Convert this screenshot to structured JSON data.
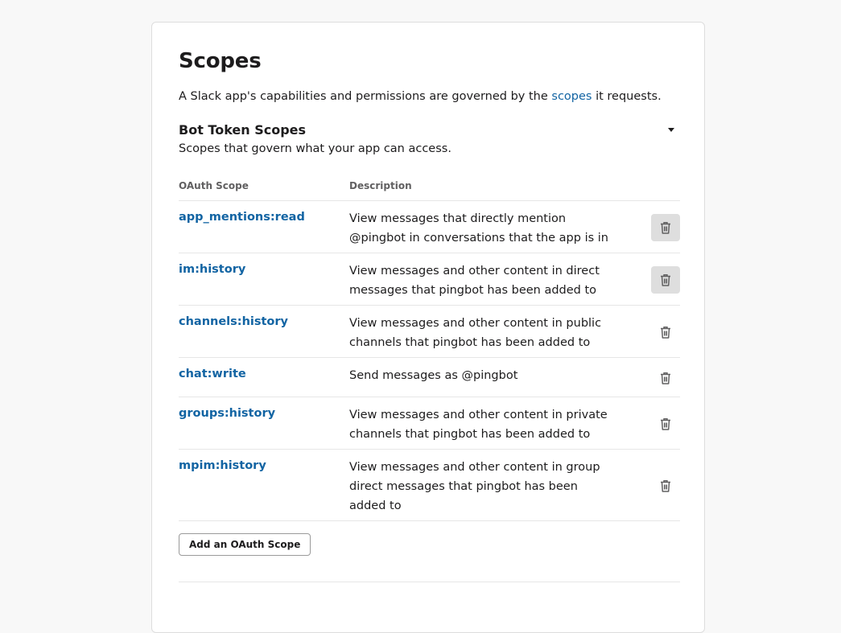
{
  "page": {
    "title": "Scopes",
    "intro_before": "A Slack app's capabilities and permissions are governed by the ",
    "intro_link": "scopes",
    "intro_after": " it requests."
  },
  "section": {
    "title": "Bot Token Scopes",
    "subtitle": "Scopes that govern what your app can access.",
    "toggle_icon": "caret-down-icon"
  },
  "table": {
    "headers": {
      "scope": "OAuth Scope",
      "description": "Description"
    },
    "rows": [
      {
        "scope": "app_mentions:read",
        "description": "View messages that directly mention @pingbot in conversations that the app is in",
        "delete_icon": "trash-icon",
        "highlighted": true
      },
      {
        "scope": "im:history",
        "description": "View messages and other content in direct messages that pingbot has been added to",
        "delete_icon": "trash-icon",
        "highlighted": true
      },
      {
        "scope": "channels:history",
        "description": "View messages and other content in public channels that pingbot has been added to",
        "delete_icon": "trash-icon",
        "highlighted": false
      },
      {
        "scope": "chat:write",
        "description": "Send messages as @pingbot",
        "delete_icon": "trash-icon",
        "highlighted": false
      },
      {
        "scope": "groups:history",
        "description": "View messages and other content in private channels that pingbot has been added to",
        "delete_icon": "trash-icon",
        "highlighted": false
      },
      {
        "scope": "mpim:history",
        "description": "View messages and other content in group direct messages that pingbot has been added to",
        "delete_icon": "trash-icon",
        "highlighted": false
      }
    ]
  },
  "actions": {
    "add_scope_label": "Add an OAuth Scope"
  },
  "colors": {
    "link": "#1264a3",
    "text": "#1d1c1d",
    "muted": "#616061",
    "background": "#f8f8f8",
    "button_hover": "#dedede"
  }
}
